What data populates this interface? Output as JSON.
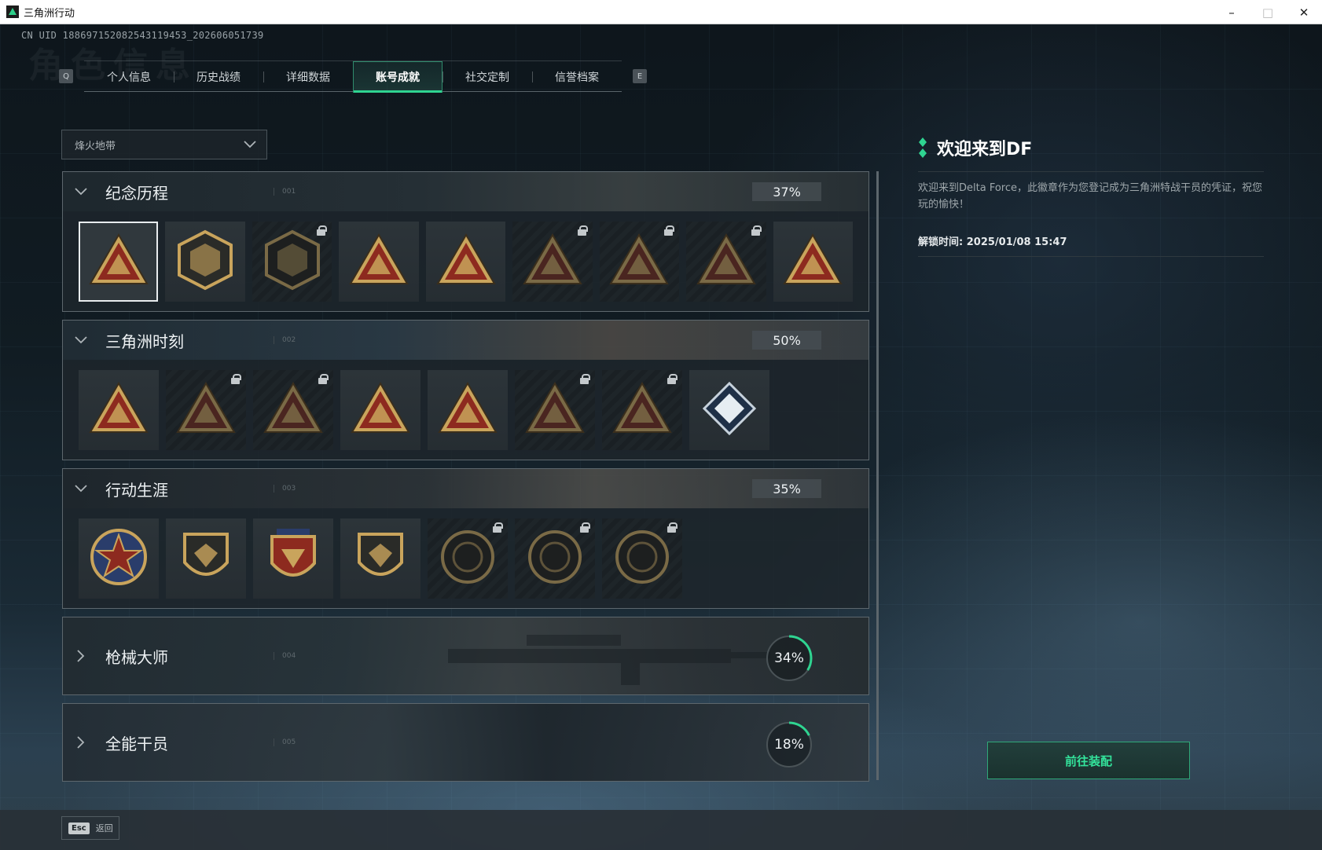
{
  "window": {
    "title": "三角洲行动",
    "min": "–",
    "max": "□",
    "close": "✕"
  },
  "uid": "CN UID 188697152082543119453_202606051739",
  "ghost_title": "角色信息",
  "tabs": {
    "left_key": "Q",
    "right_key": "E",
    "items": [
      {
        "label": "个人信息"
      },
      {
        "label": "历史战绩"
      },
      {
        "label": "详细数据"
      },
      {
        "label": "账号成就",
        "active": true
      },
      {
        "label": "社交定制"
      },
      {
        "label": "信誉档案"
      }
    ]
  },
  "dropdown": {
    "value": "烽火地带"
  },
  "sections": [
    {
      "title": "纪念历程",
      "num": "001",
      "percent": "37%",
      "badges": [
        {
          "icon": "delta-triangle-badge-icon",
          "locked": false,
          "selected": true
        },
        {
          "icon": "helicopter-badge-icon",
          "locked": false
        },
        {
          "icon": "shield-hex-badge-icon",
          "locked": true
        },
        {
          "icon": "s4-triangle-badge-icon",
          "locked": false
        },
        {
          "icon": "s7-triangle-badge-icon",
          "locked": false
        },
        {
          "icon": "soldier-triangle-badge-icon",
          "locked": true
        },
        {
          "icon": "operator-triangle-badge-icon",
          "locked": true
        },
        {
          "icon": "skull-triangle-badge-icon",
          "locked": true
        },
        {
          "icon": "number-one-triangle-badge-icon",
          "locked": false
        }
      ]
    },
    {
      "title": "三角洲时刻",
      "num": "002",
      "percent": "50%",
      "badges": [
        {
          "icon": "crate-triangle-badge-icon",
          "locked": false
        },
        {
          "icon": "crate-triangle-badge-icon",
          "locked": true
        },
        {
          "icon": "diver-triangle-badge-icon",
          "locked": true
        },
        {
          "icon": "hands-gem-triangle-badge-icon",
          "locked": false
        },
        {
          "icon": "squad-triangle-badge-icon",
          "locked": false
        },
        {
          "icon": "soldiers-triangle-badge-icon",
          "locked": true
        },
        {
          "icon": "dragon-triangle-badge-icon",
          "locked": true
        },
        {
          "icon": "book-diamond-badge-icon",
          "locked": false
        }
      ]
    },
    {
      "title": "行动生涯",
      "num": "003",
      "percent": "35%",
      "badges": [
        {
          "icon": "star-medal-badge-icon",
          "locked": false
        },
        {
          "icon": "shield-chevron-badge-icon",
          "locked": false
        },
        {
          "icon": "eagle-crest-badge-icon",
          "locked": false
        },
        {
          "icon": "gem-shield-badge-icon",
          "locked": false
        },
        {
          "icon": "pearl-circle-badge-icon",
          "locked": true
        },
        {
          "icon": "skull-circle-badge-icon",
          "locked": true
        },
        {
          "icon": "eye-circle-badge-icon",
          "locked": true
        }
      ]
    },
    {
      "title": "枪械大师",
      "num": "004",
      "percent": "34%",
      "progress": 0.34,
      "collapsed": true
    },
    {
      "title": "全能干员",
      "num": "005",
      "percent": "18%",
      "progress": 0.18,
      "collapsed": true
    }
  ],
  "welcome": {
    "title": "欢迎来到DF",
    "desc": "欢迎来到Delta Force，此徽章作为您登记成为三角洲特战干员的凭证，祝您玩的愉快！",
    "time_label": "解锁时间: 2025/01/08 15:47"
  },
  "equip_button": "前往装配",
  "back": {
    "key": "Esc",
    "label": "返回"
  },
  "colors": {
    "accent": "#2fd491",
    "gold": "#c9a45c",
    "red": "#8d2a1f"
  }
}
